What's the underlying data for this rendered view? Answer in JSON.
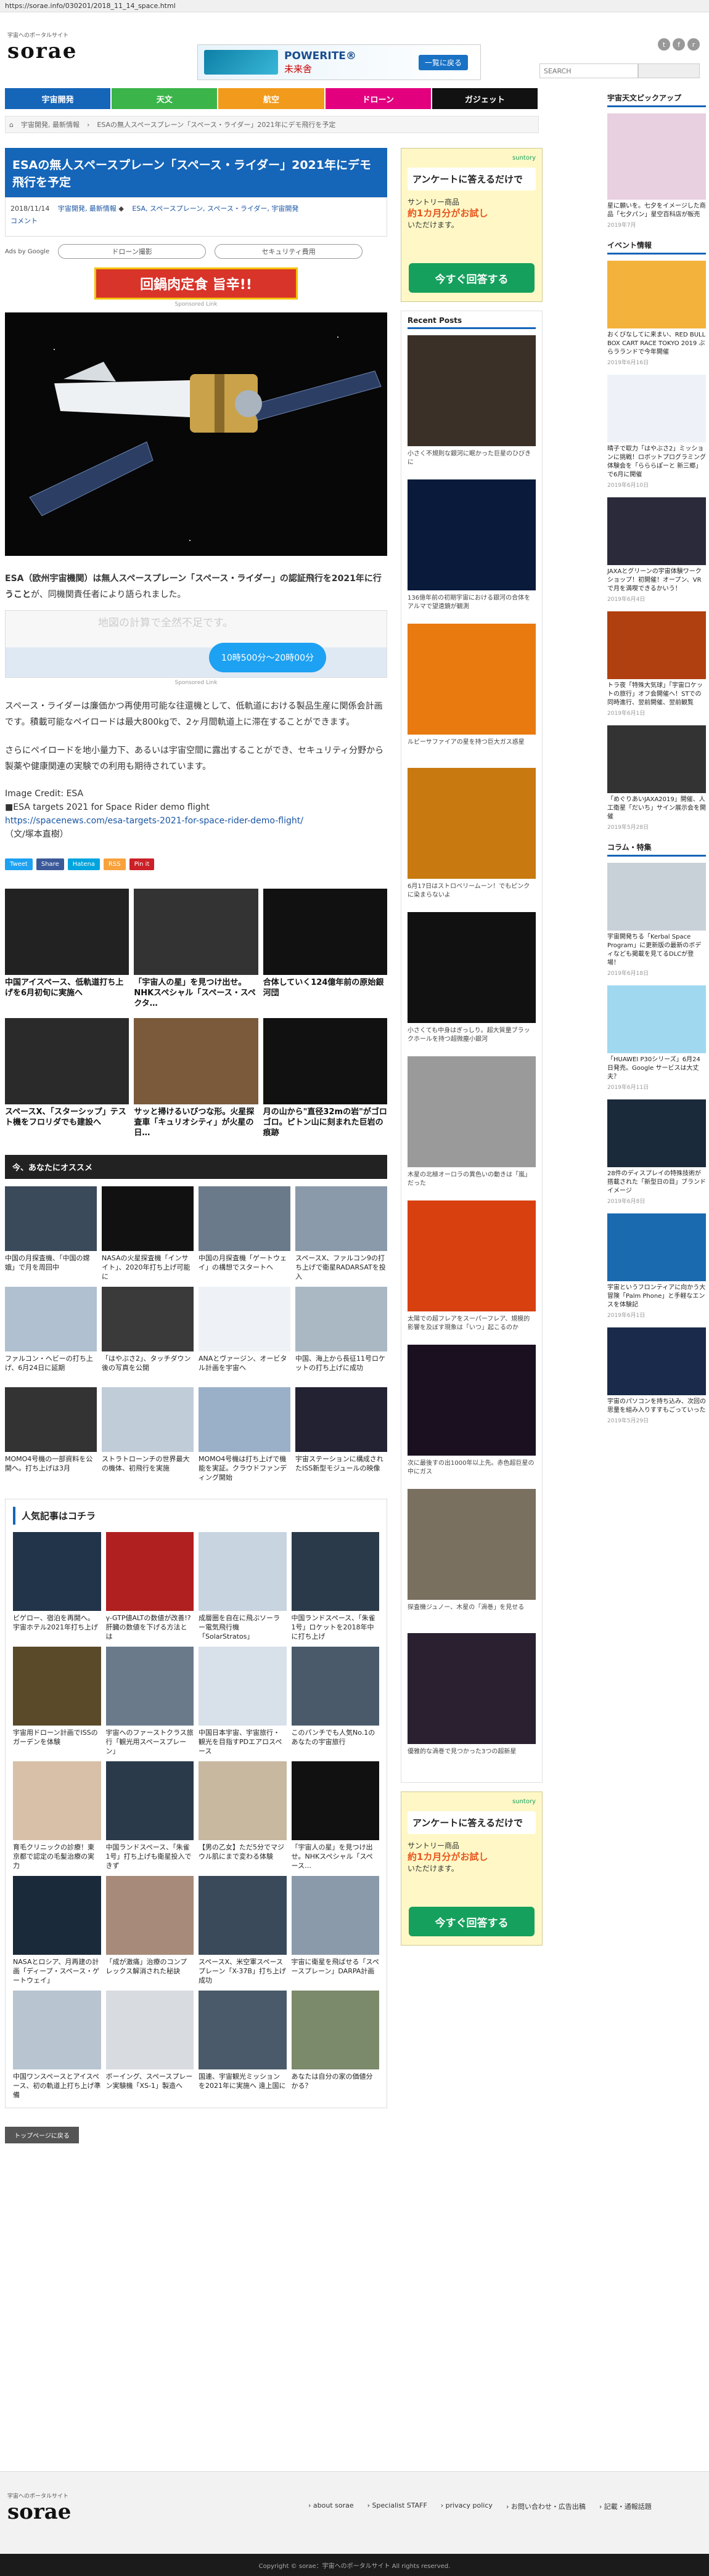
{
  "url": "https://sorae.info/030201/2018_11_14_space.html",
  "site": {
    "tagline": "宇宙へのポータルサイト",
    "name": "sorae"
  },
  "topad": {
    "brand": "POWERITE®",
    "sub": "未来舎",
    "cta": "一覧に戻る"
  },
  "search": {
    "placeholder": "SEARCH",
    "button": ""
  },
  "nav": [
    {
      "label": "宇宙開発",
      "color": "#1565b8"
    },
    {
      "label": "天文",
      "color": "#3bb54a"
    },
    {
      "label": "航空",
      "color": "#f29a1b"
    },
    {
      "label": "ドローン",
      "color": "#e3007f"
    },
    {
      "label": "ガジェット",
      "color": "#111111"
    }
  ],
  "breadcrumb": [
    "宇宙開発, 最新情報",
    "ESAの無人スペースプレーン「スペース・ライダー」2021年にデモ飛行を予定"
  ],
  "article": {
    "title": "ESAの無人スペースプレーン「スペース・ライダー」2021年にデモ飛行を予定",
    "date": "2018/11/14",
    "cats": [
      "宇宙開発, 最新情報",
      "ESA, スペースプレーン, スペース・ライダー, 宇宙開発"
    ],
    "comment": "コメント",
    "adsby": "Ads by Google",
    "pill1": "ドローン撮影",
    "pill2": "セキュリティ費用",
    "banner": "回鍋肉定食 旨辛!!",
    "sponsored": "Sponsored Link",
    "lead_bold": "ESA（欧州宇宙機関）は無人スペースプレーン「スペース・ライダー」の認証飛行を2021年に行うこと",
    "lead_rest": "が、同機関責任者により語られました。",
    "mapad_dim": "地図の計算で全然不足です。",
    "mapad_price": "10時500分〜20時00分",
    "para1": "スペース・ライダーは廉価かつ再使用可能な往還機として、低軌道における製品生産に関係会計画です。積載可能なペイロードは最大800kgで、2ヶ月間軌道上に滞在することができます。",
    "para2": "さらにペイロードを地小量力下、あるいは宇宙空間に露出することができ、セキュリティ分野から製薬や健康関連の実験での利用も期待されています。",
    "credit": "Image Credit: ESA",
    "link1": "■ESA targets 2021 for Space Rider demo flight",
    "link2": "https://spacenews.com/esa-targets-2021-for-space-rider-demo-flight/",
    "author": "（文/塚本直樹）"
  },
  "share": [
    {
      "label": "Tweet",
      "color": "#1da1f2"
    },
    {
      "label": "Share",
      "color": "#3b5998"
    },
    {
      "label": "Hatena",
      "color": "#00a4de"
    },
    {
      "label": "RSS",
      "color": "#f7a23c"
    },
    {
      "label": "Pin it",
      "color": "#cb2027"
    }
  ],
  "related": [
    {
      "cap": "中国アイスペース、低軌道打ち上げを6月初旬に実施へ",
      "c": "#222"
    },
    {
      "cap": "「宇宙人の星」を見つけ出せ。NHKスペシャル「スペース・スペクタ…",
      "c": "#333"
    },
    {
      "cap": "合体していく124億年前の原始銀河団",
      "c": "#111"
    },
    {
      "cap": "スペースX、「スターシップ」テスト機をフロリダでも建設へ",
      "c": "#2a2a2a"
    },
    {
      "cap": "サッと掃けるいびつな形。火星探査車「キュリオシティ」が火星の日…",
      "c": "#7a5a3a"
    },
    {
      "cap": "月の山から\"直径32mの岩\"がゴロゴロ。ピトン山に刻まれた巨岩の痕跡",
      "c": "#111"
    }
  ],
  "recommend_title": "今、あなたにオススメ",
  "recommend": [
    {
      "cap": "中国の月探査機、「中国の嫦娥」で月を周回中",
      "c": "#3a4a5a"
    },
    {
      "cap": "NASAの火星探査機「インサイト」、2020年打ち上げ可能に",
      "c": "#111"
    },
    {
      "cap": "中国の月探査機「ゲートウェイ」の構想でスタートへ",
      "c": "#6a7a8a"
    },
    {
      "cap": "スペースX、ファルコン9の打ち上げで衛星RADARSATを投入",
      "c": "#8a9aaa"
    },
    {
      "cap": "ファルコン・ヘビーの打ち上げ、6月24日に延期",
      "c": "#b0c0d0"
    },
    {
      "cap": "「はやぶさ2」、タッチダウン後の写真を公開",
      "c": "#3a3a3a"
    },
    {
      "cap": "ANAとヴァージン、オービタル計画を宇宙へ",
      "c": "#eef2f6"
    },
    {
      "cap": "中国、海上から長征11号ロケットの打ち上げに成功",
      "c": "#aab8c4"
    },
    {
      "cap": "MOMO4号機の一部資料を公開へ。打ち上げは3月",
      "c": "#333"
    },
    {
      "cap": "ストラトローンチの世界最大の機体、初飛行を実施",
      "c": "#c0ccd8"
    },
    {
      "cap": "MOMO4号機は打ち上げで機能を実証。クラウドファンディング開始",
      "c": "#9ab0c8"
    },
    {
      "cap": "宇宙ステーションに構成されたISS新型モジュールの映像",
      "c": "#223"
    }
  ],
  "popular_title": "人気記事はコチラ",
  "popular": [
    {
      "cap": "ビゲロー、宿泊を再開へ。宇宙ホテル2021年打ち上げ",
      "c": "#22344a"
    },
    {
      "cap": "γ-GTP値ALTの数値が改善!? 肝臓の数値を下げる方法とは",
      "c": "#b02020"
    },
    {
      "cap": "成層圏を自在に飛ぶソーラー電気飛行機「SolarStratos」",
      "c": "#c8d4e0"
    },
    {
      "cap": "中国ランドスペース、「朱雀1号」ロケットを2018年中に打ち上げ",
      "c": "#2a3a4a"
    },
    {
      "cap": "宇宙用ドローン計画でISSのガーデンを体験",
      "c": "#5a4a2a"
    },
    {
      "cap": "宇宙へのファーストクラス旅行「観光用スペースプレーン」",
      "c": "#6a7a8a"
    },
    {
      "cap": "中国日本宇宙、宇宙旅行・観光を目指すPDエアロスペース",
      "c": "#d8e0ea"
    },
    {
      "cap": "このパンチでも人気No.1のあなたの宇宙旅行",
      "c": "#4a5a6a"
    },
    {
      "cap": "育毛クリニックの診療！東京都で認定の毛髪治療の実力",
      "c": "#d8c0a8"
    },
    {
      "cap": "中国ランドスペース、「朱雀1号」打ち上げも衛星投入できず",
      "c": "#2a3a4a"
    },
    {
      "cap": "【男の乙女】ただ5分でマジウル肌にまで変わる体験",
      "c": "#c8b8a0"
    },
    {
      "cap": "「宇宙人の星」を見つけ出せ。NHKスペシャル「スペース…",
      "c": "#111"
    },
    {
      "cap": "NASAとロシア、月再建の計画「ディープ・スペース・ゲートウェイ」",
      "c": "#1a2a3a"
    },
    {
      "cap": "「成が激痛」治療のコンプレックス解消された秘訣",
      "c": "#a88a7a"
    },
    {
      "cap": "スペースX、米空軍スペースプレーン「X-37B」打ち上げ成功",
      "c": "#3a4a5a"
    },
    {
      "cap": "宇宙に衛星を飛ばせる「スペースプレーン」DARPA計画",
      "c": "#8a9aaa"
    },
    {
      "cap": "中国ワンスペースとアイスペース、初の軌道上打ち上げ準備",
      "c": "#b8c4d0"
    },
    {
      "cap": "ボーイング、スペースプレーン実験機「XS-1」製造へ",
      "c": "#d8dce0"
    },
    {
      "cap": "国連、宇宙観光ミッションを2021年に実施へ 遠上国に",
      "c": "#4a5a6a"
    },
    {
      "cap": "あなたは自分の家の価値分かる？",
      "c": "#7a8a6a"
    }
  ],
  "pr_button": "トップページに戻る",
  "survey": {
    "brand": "suntory",
    "q": "アンケートに答えるだけで",
    "prod_a": "サントリー商品",
    "prod_b": "約1カ月分がお試し",
    "prod_c": "いただけます。",
    "btn": "今すぐ回答する"
  },
  "recent_title": "Recent Posts",
  "recent": [
    {
      "cap": "小さく不規則な銀河に眠かった巨星のひびきに",
      "c": "#3a3028"
    },
    {
      "cap": "136億年前の初期宇宙における銀河の合体をアルマで望遠鏡が観測",
      "c": "#0a1a3a"
    },
    {
      "cap": "ルビーサファイアの星を持つ巨大ガス惑星",
      "c": "#e87a10"
    },
    {
      "cap": "6月17日はストロベリームーン！でもピンクに染まらないよ",
      "c": "#c87a10"
    },
    {
      "cap": "小さくても中身はぎっしり。超大質量ブラックホールを持つ超微塵小銀河",
      "c": "#111"
    },
    {
      "cap": "木星の北極オーロラの異色いの動きは「嵐」だった",
      "c": "#9a9a9a"
    },
    {
      "cap": "太陽での超フレアをスーパーフレア、規模的影響を及ぼす現象は「いつ」起こるのか",
      "c": "#d84010"
    },
    {
      "cap": "次に最後すの出1000年以上先。赤色超巨星の中にガス",
      "c": "#1a1020"
    },
    {
      "cap": "探査機ジュノー、木星の「渦巻」を見せる",
      "c": "#7a7060"
    },
    {
      "cap": "優雅的な渦巻で見つかった3つの超新星",
      "c": "#2a2030"
    }
  ],
  "right_title1": "宇宙天文ピックアップ",
  "right_pick": {
    "cap": "星に願いを。七夕をイメージした商品「七夕パン」星空百科店が販売",
    "date": "2019年7月",
    "c": "#e8d0e0"
  },
  "right_title2": "イベント情報",
  "events": [
    {
      "cap": "おくびなしてに来まい、RED BULL BOX CART RACE TOKYO 2019 ぶらラランドで今年開催",
      "date": "2019年6月16日",
      "c": "#f3b23c"
    },
    {
      "cap": "晴子で取力「はやぶさ2」ミッションに挑戦！ロボットプログラミング体験会を「らららぽーと 新三郷」で6月に開催",
      "date": "2019年6月10日",
      "c": "#eef2f8"
    },
    {
      "cap": "JAXAとグリーンの宇宙体験ワークショップ！初開催！オープン、VRで月を満喫できるかいう！",
      "date": "2019年6月4日",
      "c": "#2a2a3a"
    },
    {
      "cap": "トラ夜「特殊大気球」「宇宙ロケットの旅行」オフ会開催へ！STでの同時進行、翌前開催、翌前観覧",
      "date": "2019年6月1日",
      "c": "#b04010"
    },
    {
      "cap": "「めぐりあいJAXA2019」開催、人工衛星「だいち」サイン展示会を開催",
      "date": "2019年5月28日",
      "c": "#333"
    }
  ],
  "right_title3": "コラム・特集",
  "columns": [
    {
      "cap": "宇宙開発ちる「Kerbal Space Program」に更新版の最新のボディなども掲載を見てるDLCが登場！",
      "date": "2019年6月18日",
      "c": "#c8d0d8"
    },
    {
      "cap": "「HUAWEI P30シリーズ」6月24日発売。Google サービスは大丈夫？",
      "date": "2019年6月11日",
      "c": "#a0d8f0"
    },
    {
      "cap": "28件のディスプレイの特殊技術が搭載された「新型日の目」ブランドイメージ",
      "date": "2019年6月8日",
      "c": "#1a2a3a"
    },
    {
      "cap": "宇宙というフロンティアに向かう大冒険「Palm Phone」と手軽なエンスを体験記",
      "date": "2019年6月1日",
      "c": "#1a6ab0"
    },
    {
      "cap": "宇宙のパソコンを持ち込み、次回の思量を組み入りすすもごっていった",
      "date": "2019年5月29日",
      "c": "#1a2a4a"
    }
  ],
  "footer": {
    "tagline": "宇宙へのポータルサイト",
    "name": "sorae",
    "links": [
      "about sorae",
      "Specialist STAFF",
      "privacy policy",
      "お問い合わせ・広告出稿",
      "記載・通報話題"
    ],
    "copy": "Copyright © sorae：宇宙へのポータルサイト All rights reserved."
  }
}
